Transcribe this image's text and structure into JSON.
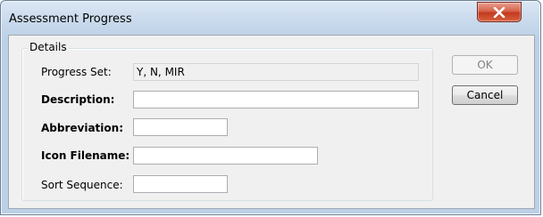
{
  "window": {
    "title": "Assessment Progress"
  },
  "details": {
    "group_label": "Details",
    "progress_set": {
      "label": "Progress Set:",
      "value": "Y, N, MIR"
    },
    "description": {
      "label": "Description:",
      "value": ""
    },
    "abbreviation": {
      "label": "Abbreviation:",
      "value": ""
    },
    "icon_filename": {
      "label": "Icon Filename:",
      "value": ""
    },
    "sort_sequence": {
      "label": "Sort Sequence:",
      "value": ""
    }
  },
  "buttons": {
    "ok": "OK",
    "cancel": "Cancel"
  },
  "icons": {
    "close": "close-icon"
  }
}
